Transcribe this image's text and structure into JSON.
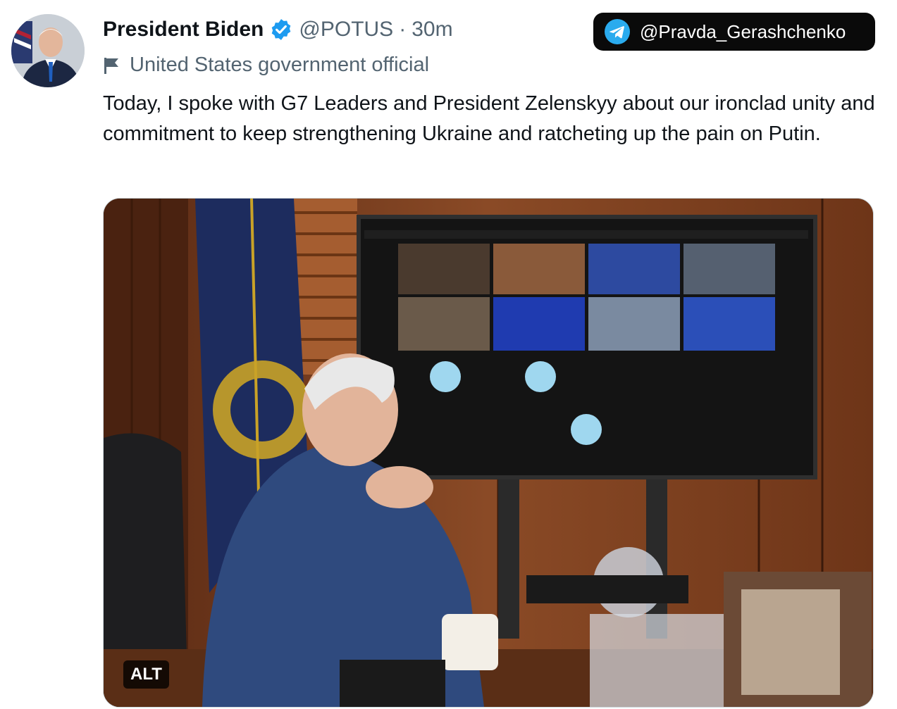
{
  "tweet": {
    "author": {
      "display_name": "President Biden",
      "handle": "@POTUS",
      "separator": "·",
      "time": "30m",
      "verified": true,
      "label": "United States government official"
    },
    "text": "Today, I spoke with G7 Leaders and President Zelenskyy about our ironclad unity and commitment to keep strengthening Ukraine and ratcheting up the pain on Putin.",
    "media": {
      "alt_badge": "ALT"
    }
  },
  "watermark": {
    "text": "@Pravda_Gerashchenko",
    "icon": "telegram-icon"
  },
  "colors": {
    "verified_blue": "#1d9bf0",
    "secondary_text": "#536471",
    "primary_text": "#0f1419",
    "telegram_blue": "#2aabee"
  }
}
